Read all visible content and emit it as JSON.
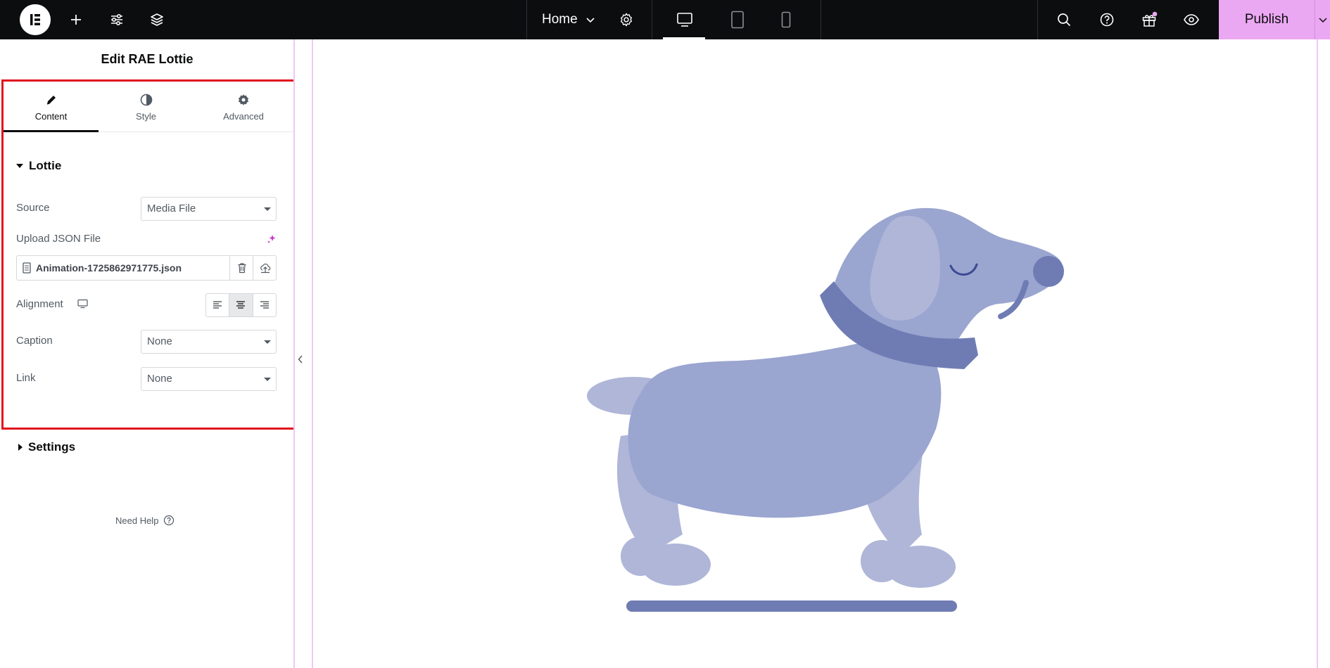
{
  "topbar": {
    "logo_icon": "elementor-logo-icon",
    "add_icon": "plus-icon",
    "settings_icon": "sliders-icon",
    "structure_icon": "layers-icon",
    "page_name": "Home",
    "page_dropdown_icon": "chevron-down-icon",
    "page_settings_icon": "gear-icon",
    "devices": [
      {
        "name": "desktop-icon",
        "active": true
      },
      {
        "name": "tablet-icon",
        "active": false
      },
      {
        "name": "mobile-icon",
        "active": false
      }
    ],
    "search_icon": "search-icon",
    "help_icon": "question-icon",
    "whats_new_icon": "gift-icon",
    "preview_icon": "eye-icon",
    "publish_label": "Publish",
    "accent_color": "#eba8f2"
  },
  "panel": {
    "title": "Edit RAE Lottie",
    "tabs": [
      {
        "label": "Content",
        "icon": "pencil-icon",
        "active": true
      },
      {
        "label": "Style",
        "icon": "half-circle-icon",
        "active": false
      },
      {
        "label": "Advanced",
        "icon": "gear-icon",
        "active": false
      }
    ],
    "lottie_section": {
      "title": "Lottie",
      "source_label": "Source",
      "source_value": "Media File",
      "upload_label": "Upload JSON File",
      "ai_icon": "sparkle-icon",
      "file_name": "Animation-1725862971775.json",
      "file_icon": "document-icon",
      "delete_icon": "trash-icon",
      "upload_icon": "upload-icon",
      "alignment_label": "Alignment",
      "responsive_icon": "desktop-icon",
      "alignment_options": [
        "align-left-icon",
        "align-center-icon",
        "align-right-icon"
      ],
      "alignment_active": "align-center-icon",
      "caption_label": "Caption",
      "caption_value": "None",
      "link_label": "Link",
      "link_value": "None"
    },
    "settings_section": {
      "title": "Settings"
    },
    "need_help": "Need Help",
    "highlight_color": "#e0121c"
  }
}
